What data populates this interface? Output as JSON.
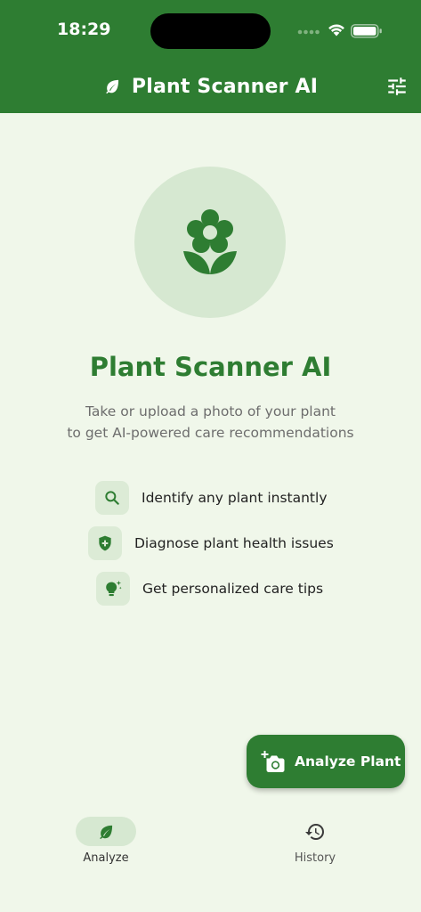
{
  "status_bar": {
    "time": "18:29"
  },
  "app_bar": {
    "title": "Plant Scanner AI",
    "leading_icon": "leaf-icon",
    "action_icon": "tune-icon"
  },
  "hero": {
    "icon": "flower-icon"
  },
  "main": {
    "title": "Plant Scanner AI",
    "subtitle_line1": "Take or upload a photo of your plant",
    "subtitle_line2": "to get AI-powered care recommendations"
  },
  "features": [
    {
      "icon": "search-icon",
      "label": "Identify any plant instantly"
    },
    {
      "icon": "health-shield-icon",
      "label": "Diagnose plant health issues"
    },
    {
      "icon": "lightbulb-sparkle-icon",
      "label": "Get personalized care tips"
    }
  ],
  "fab": {
    "label": "Analyze Plant",
    "icon": "add-camera-icon"
  },
  "bottom_nav": {
    "items": [
      {
        "label": "Analyze",
        "icon": "leaf-icon",
        "active": true
      },
      {
        "label": "History",
        "icon": "history-icon",
        "active": false
      }
    ]
  },
  "colors": {
    "primary": "#2e7d32",
    "background": "#f0f7ea",
    "hero_circle": "#d6e8d1",
    "chip": "#dcebd6"
  }
}
